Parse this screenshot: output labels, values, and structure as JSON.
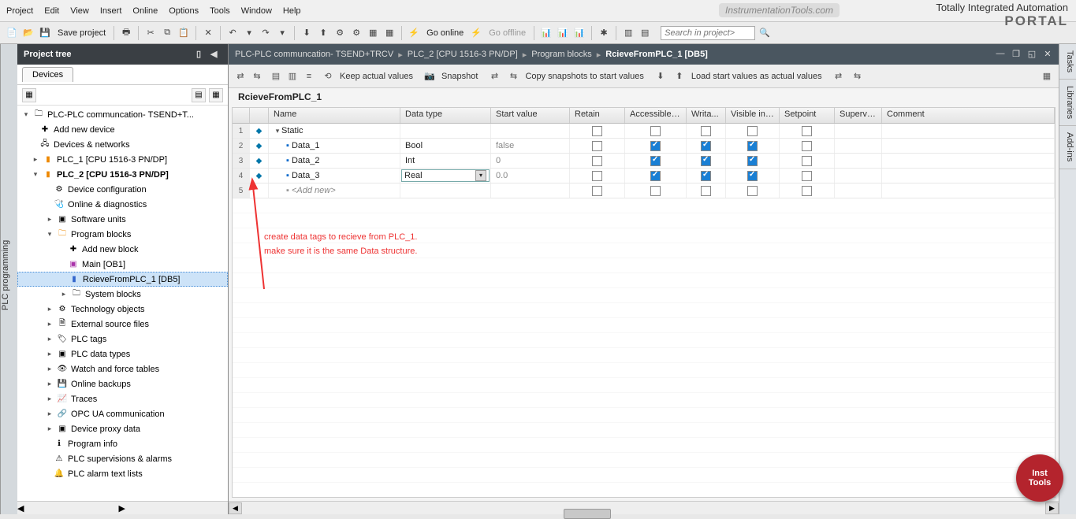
{
  "menu": {
    "items": [
      "Project",
      "Edit",
      "View",
      "Insert",
      "Online",
      "Options",
      "Tools",
      "Window",
      "Help"
    ]
  },
  "brand": {
    "watermark": "InstrumentationTools.com",
    "tia": "Totally Integrated Automation",
    "portal": "PORTAL"
  },
  "toolbar": {
    "save": "Save project",
    "goonline": "Go online",
    "gooffline": "Go offline",
    "search_ph": "Search in project>"
  },
  "pt": {
    "title": "Project tree",
    "devices_tab": "Devices"
  },
  "tree": {
    "root": "PLC-PLC communcation- TSEND+T...",
    "add_device": "Add new device",
    "devnet": "Devices & networks",
    "plc1": "PLC_1 [CPU 1516-3 PN/DP]",
    "plc2": "PLC_2 [CPU 1516-3 PN/DP]",
    "devcfg": "Device configuration",
    "onldiag": "Online & diagnostics",
    "swunits": "Software units",
    "progblocks": "Program blocks",
    "addblock": "Add new block",
    "main": "Main [OB1]",
    "rcv": "RcieveFromPLC_1 [DB5]",
    "sysblocks": "System blocks",
    "techobj": "Technology objects",
    "extfiles": "External source files",
    "plctags": "PLC tags",
    "plcdt": "PLC data types",
    "watch": "Watch and force tables",
    "backups": "Online backups",
    "traces": "Traces",
    "opcua": "OPC UA communication",
    "devproxy": "Device proxy data",
    "proginfo": "Program info",
    "plcsup": "PLC supervisions & alarms",
    "alarmtxt": "PLC alarm text lists"
  },
  "bc": {
    "p1": "PLC-PLC communcation- TSEND+TRCV",
    "p2": "PLC_2 [CPU 1516-3 PN/DP]",
    "p3": "Program blocks",
    "p4": "RcieveFromPLC_1 [DB5]"
  },
  "edtb": {
    "keep": "Keep actual values",
    "snap": "Snapshot",
    "copy": "Copy snapshots to start values",
    "load": "Load start values as actual values"
  },
  "db": {
    "name": "RcieveFromPLC_1"
  },
  "cols": {
    "name": "Name",
    "dt": "Data type",
    "sv": "Start value",
    "ret": "Retain",
    "acc": "Accessible f...",
    "wr": "Writa...",
    "vis": "Visible in ...",
    "sp": "Setpoint",
    "sup": "Supervis...",
    "com": "Comment"
  },
  "rows": {
    "r1": {
      "n": "1",
      "name": "Static"
    },
    "r2": {
      "n": "2",
      "name": "Data_1",
      "dt": "Bool",
      "sv": "false"
    },
    "r3": {
      "n": "3",
      "name": "Data_2",
      "dt": "Int",
      "sv": "0"
    },
    "r4": {
      "n": "4",
      "name": "Data_3",
      "dt": "Real",
      "sv": "0.0"
    },
    "r5": {
      "n": "5",
      "name": "<Add new>"
    }
  },
  "annot": {
    "l1": "create data tags to recieve from PLC_1.",
    "l2": "make sure it is the same Data structure."
  },
  "rrail": {
    "t1": "Tasks",
    "t2": "Libraries",
    "t3": "Add-ins"
  },
  "leftrail": "PLC programming",
  "badge": {
    "l1": "Inst",
    "l2": "Tools"
  }
}
